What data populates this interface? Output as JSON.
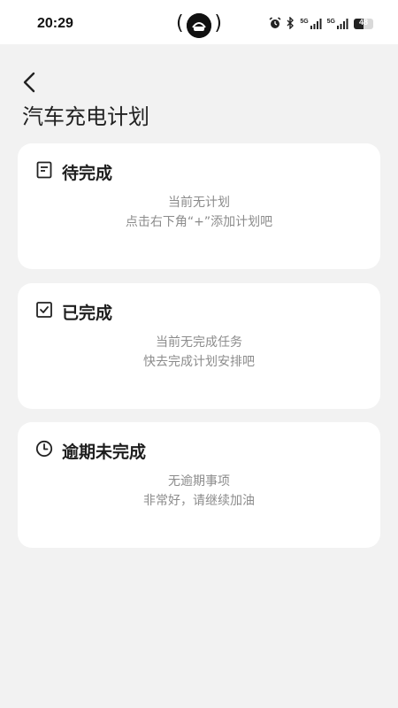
{
  "status_bar": {
    "time": "20:29",
    "network_label_1": "5G",
    "network_label_2": "5G",
    "battery_level": "48",
    "battery_fraction": 0.48
  },
  "header": {
    "title": "汽车充电计划"
  },
  "sections": [
    {
      "title": "待完成",
      "icon": "document-icon",
      "line1": "当前无计划",
      "line2": "点击右下角“+”添加计划吧"
    },
    {
      "title": "已完成",
      "icon": "checkbox-icon",
      "line1": "当前无完成任务",
      "line2": "快去完成计划安排吧"
    },
    {
      "title": "逾期未完成",
      "icon": "clock-icon",
      "line1": "无逾期事项",
      "line2": "非常好，请继续加油"
    }
  ],
  "colors": {
    "background": "#f2f2f2",
    "card": "#ffffff",
    "text_primary": "#1e1e1e",
    "text_secondary": "#8c8c8c"
  }
}
